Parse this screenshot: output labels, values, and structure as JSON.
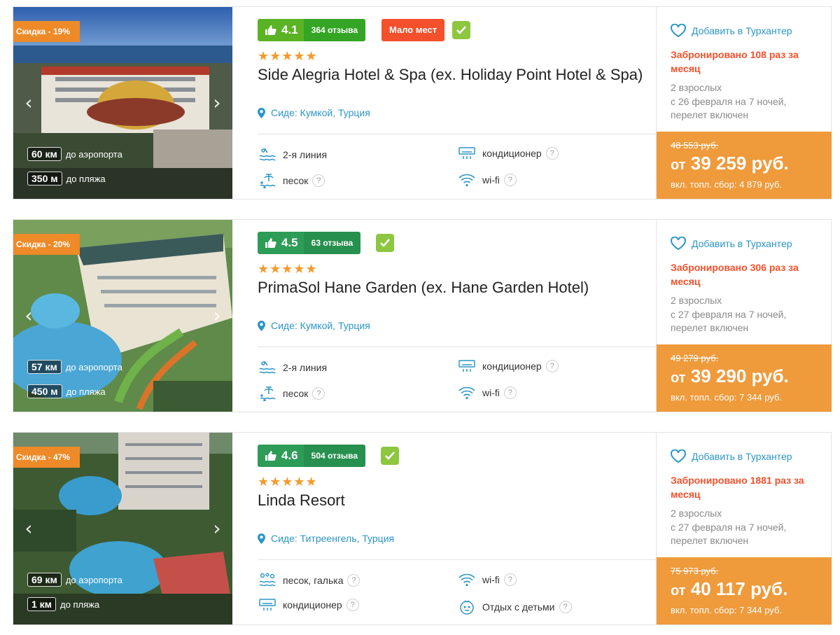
{
  "cards": [
    {
      "discount": "Скидка - 19%",
      "airport_val": "60 км",
      "airport_label": "до аэропорта",
      "beach_val": "350 м",
      "beach_label": "до пляжа",
      "rating": "4.1",
      "reviews": "364 отзыва",
      "badge": "Мало мест",
      "stars": "★★★★★",
      "name": "Side Alegria Hotel & Spa (ex. Holiday Point Hotel & Spa)",
      "location": "Сиде: Кумкой, Турция",
      "features": [
        "2-я линия",
        "кондиционер",
        "песок",
        "wi-fi"
      ],
      "favorite": "Добавить в Турхантер",
      "booked": "Забронировано 108 раз за месяц",
      "pax1": "2 взрослых",
      "pax2": "с 26 февраля на 7 ночей,",
      "pax3": "перелет включен",
      "old_price": "48 553 руб.",
      "price_from": "от",
      "price": "39 259 руб.",
      "fee": "вкл. топл. сбор: 4 879 руб."
    },
    {
      "discount": "Скидка - 20%",
      "airport_val": "57 км",
      "airport_label": "до аэропорта",
      "beach_val": "450 м",
      "beach_label": "до пляжа",
      "rating": "4.5",
      "reviews": "63 отзыва",
      "stars": "★★★★★",
      "name": "PrimaSol Hane Garden (ex. Hane Garden Hotel)",
      "location": "Сиде: Кумкой, Турция",
      "features": [
        "2-я линия",
        "кондиционер",
        "песок",
        "wi-fi"
      ],
      "favorite": "Добавить в Турхантер",
      "booked": "Забронировано 306 раз за месяц",
      "pax1": "2 взрослых",
      "pax2": "с 27 февраля на 7 ночей,",
      "pax3": "перелет включен",
      "old_price": "49 279 руб.",
      "price_from": "от",
      "price": "39 290 руб.",
      "fee": "вкл. топл. сбор: 7 344 руб."
    },
    {
      "discount": "Скидка - 47%",
      "airport_val": "69 км",
      "airport_label": "до аэропорта",
      "beach_val": "1 км",
      "beach_label": "до пляжа",
      "rating": "4.6",
      "reviews": "504 отзыва",
      "stars": "★★★★★",
      "name": "Linda Resort",
      "location": "Сиде: Титреенгель, Турция",
      "features": [
        "песок, галька",
        "wi-fi",
        "кондиционер",
        "Отдых с детьми"
      ],
      "favorite": "Добавить в Турхантер",
      "booked": "Забронировано 1881 раз за месяц",
      "pax1": "2 взрослых",
      "pax2": "с 27 февраля на 7 ночей,",
      "pax3": "перелет включен",
      "old_price": "75 973 руб.",
      "price_from": "от",
      "price": "40 117 руб.",
      "fee": "вкл. топл. сбор: 7 344 руб."
    }
  ],
  "colors": {
    "discount": "#ee8a27",
    "rating_green": "#5ab325",
    "few_places": "#f4502b",
    "link_blue": "#2b96c7",
    "price_orange": "#ef9a3b"
  }
}
